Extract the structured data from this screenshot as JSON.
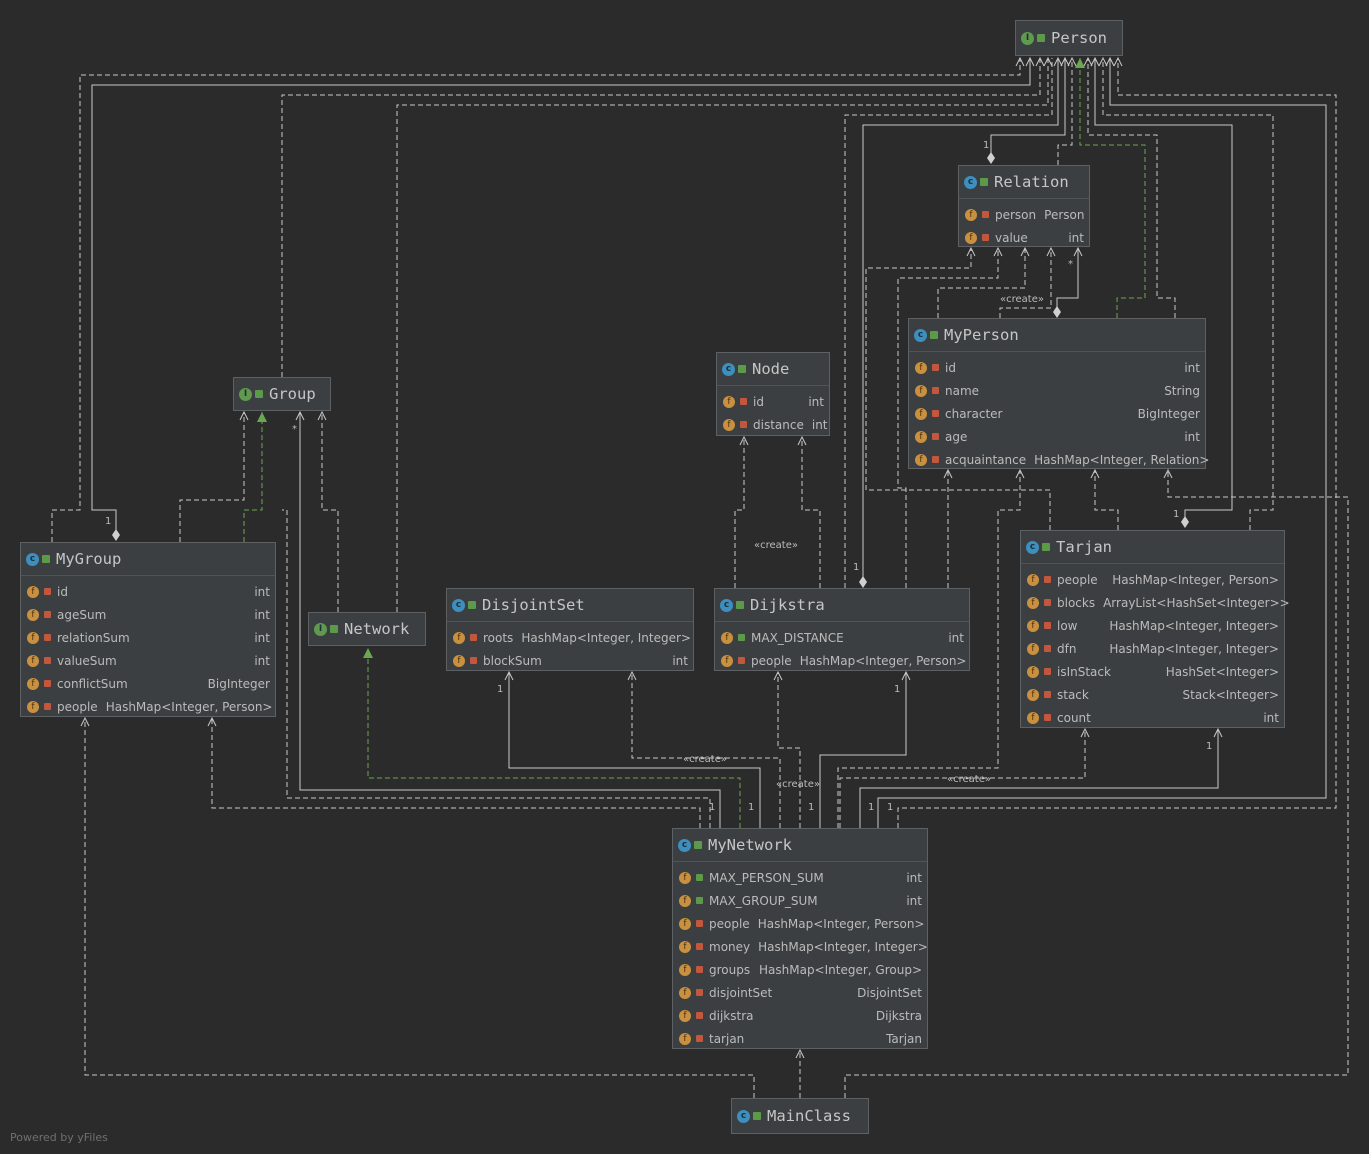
{
  "footer": "Powered by yFiles",
  "colors": {
    "background": "#2b2b2b",
    "box": "#3c3f41",
    "edge": "#c8c8c8",
    "realization": "#6aa84f",
    "class_icon": "#3d8fbf",
    "interface_icon": "#5f9a4f",
    "field_icon": "#c9913f"
  },
  "nodes": {
    "person": {
      "title": "Person",
      "kind": "interface",
      "fields": []
    },
    "relation": {
      "title": "Relation",
      "kind": "class",
      "fields": [
        {
          "name": "person",
          "type": "Person"
        },
        {
          "name": "value",
          "type": "int"
        }
      ]
    },
    "myperson": {
      "title": "MyPerson",
      "kind": "class",
      "fields": [
        {
          "name": "id",
          "type": "int"
        },
        {
          "name": "name",
          "type": "String"
        },
        {
          "name": "character",
          "type": "BigInteger"
        },
        {
          "name": "age",
          "type": "int"
        },
        {
          "name": "acquaintance",
          "type": "HashMap<Integer, Relation>"
        }
      ]
    },
    "node": {
      "title": "Node",
      "kind": "class",
      "fields": [
        {
          "name": "id",
          "type": "int"
        },
        {
          "name": "distance",
          "type": "int"
        }
      ]
    },
    "group": {
      "title": "Group",
      "kind": "interface",
      "fields": []
    },
    "mygroup": {
      "title": "MyGroup",
      "kind": "class",
      "fields": [
        {
          "name": "id",
          "type": "int"
        },
        {
          "name": "ageSum",
          "type": "int"
        },
        {
          "name": "relationSum",
          "type": "int"
        },
        {
          "name": "valueSum",
          "type": "int"
        },
        {
          "name": "conflictSum",
          "type": "BigInteger"
        },
        {
          "name": "people",
          "type": "HashMap<Integer, Person>"
        }
      ]
    },
    "network": {
      "title": "Network",
      "kind": "interface",
      "fields": []
    },
    "disjointset": {
      "title": "DisjointSet",
      "kind": "class",
      "fields": [
        {
          "name": "roots",
          "type": "HashMap<Integer, Integer>"
        },
        {
          "name": "blockSum",
          "type": "int"
        }
      ]
    },
    "dijkstra": {
      "title": "Dijkstra",
      "kind": "class",
      "fields": [
        {
          "name": "MAX_DISTANCE",
          "type": "int",
          "public": true
        },
        {
          "name": "people",
          "type": "HashMap<Integer, Person>"
        }
      ]
    },
    "tarjan": {
      "title": "Tarjan",
      "kind": "class",
      "fields": [
        {
          "name": "people",
          "type": "HashMap<Integer, Person>"
        },
        {
          "name": "blocks",
          "type": "ArrayList<HashSet<Integer>>"
        },
        {
          "name": "low",
          "type": "HashMap<Integer, Integer>"
        },
        {
          "name": "dfn",
          "type": "HashMap<Integer, Integer>"
        },
        {
          "name": "isInStack",
          "type": "HashSet<Integer>"
        },
        {
          "name": "stack",
          "type": "Stack<Integer>"
        },
        {
          "name": "count",
          "type": "int"
        }
      ]
    },
    "mynetwork": {
      "title": "MyNetwork",
      "kind": "class",
      "fields": [
        {
          "name": "MAX_PERSON_SUM",
          "type": "int",
          "public": true
        },
        {
          "name": "MAX_GROUP_SUM",
          "type": "int",
          "public": true
        },
        {
          "name": "people",
          "type": "HashMap<Integer, Person>"
        },
        {
          "name": "money",
          "type": "HashMap<Integer, Integer>"
        },
        {
          "name": "groups",
          "type": "HashMap<Integer, Group>"
        },
        {
          "name": "disjointSet",
          "type": "DisjointSet"
        },
        {
          "name": "dijkstra",
          "type": "Dijkstra"
        },
        {
          "name": "tarjan",
          "type": "Tarjan"
        }
      ]
    },
    "mainclass": {
      "title": "MainClass",
      "kind": "class",
      "fields": []
    }
  },
  "edge_labels": [
    "1",
    "*",
    "«create»",
    "1",
    "*",
    "«create»",
    "1",
    "1",
    "1",
    "«create»",
    "«create»",
    "1",
    "1",
    "1",
    "1",
    "1",
    "1",
    "«create»",
    "1"
  ]
}
